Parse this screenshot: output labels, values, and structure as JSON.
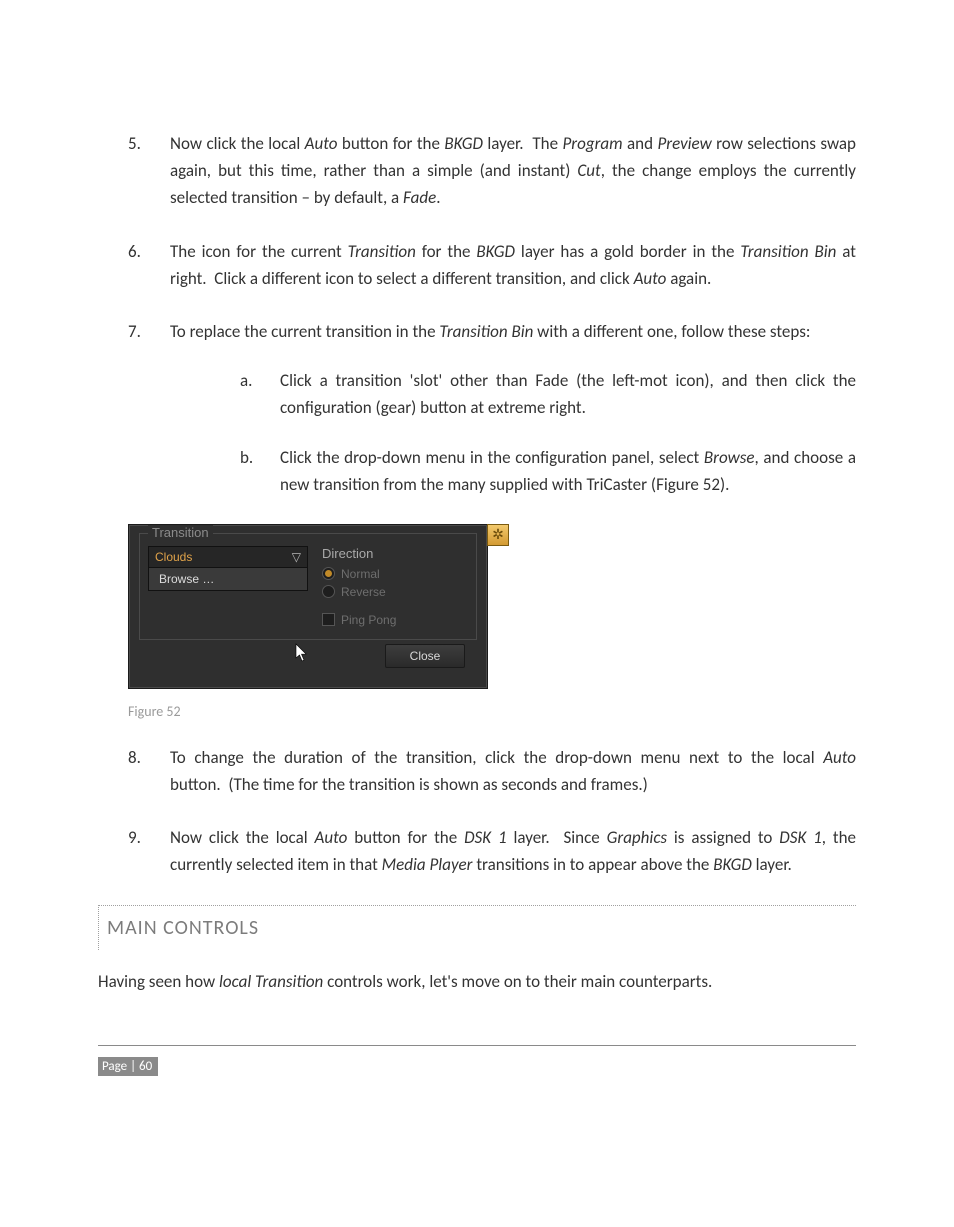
{
  "list": {
    "item5": {
      "num": "5.",
      "html": "Now click the local <em>Auto</em> button for the <em>BKGD</em> layer.&nbsp;&nbsp;The <em>Program</em> and <em>Preview</em> row selections swap again, but this time, rather than a simple (and instant) <em>Cut</em>, the change employs the currently selected transition – by default, a <em>Fade</em>."
    },
    "item6": {
      "num": "6.",
      "html": "The icon for the current <em>Transition</em> for the <em>BKGD</em> layer has a gold border in the <em>Transition Bin</em> at right.&nbsp;&nbsp;Click a different icon to select a different transition, and click <em>Auto</em> again."
    },
    "item7": {
      "num": "7.",
      "html": "To replace the current transition in the <em>Transition Bin</em> with a different one, follow these steps:",
      "a": {
        "num": "a.",
        "html": "Click a transition 'slot' other than Fade (the left-mot icon), and then click the configuration (gear) button at extreme right."
      },
      "b": {
        "num": "b.",
        "html": "Click the drop-down menu in the configuration panel, select <em>Browse</em>, and choose a new transition from the many supplied with TriCaster (Figure 52)."
      }
    },
    "item8": {
      "num": "8.",
      "html": "To change the duration of the transition, click the drop-down menu next to the local <em>Auto</em> button.&nbsp;&nbsp;(The time for the transition is shown as seconds and frames.)"
    },
    "item9": {
      "num": "9.",
      "html": "Now click the local <em>Auto</em> button for the <em>DSK 1</em> layer.&nbsp;&nbsp;Since <em>Graphics</em> is assigned to <em>DSK 1</em>, the currently selected item in that <em>Media Player</em> transitions in to appear above the <em>BKGD</em> layer."
    }
  },
  "panel": {
    "legend": "Transition",
    "dropdown_value": "Clouds",
    "dropdown_item": "Browse …",
    "direction_label": "Direction",
    "normal_label": "Normal",
    "reverse_label": "Reverse",
    "pingpong_label": "Ping Pong",
    "close_label": "Close",
    "gear_glyph": "✲",
    "cursor_glyph": "➤",
    "chevron_glyph": "▽"
  },
  "figure_caption": "Figure 52",
  "section_heading": "MAIN CONTROLS",
  "closing_para_html": "Having seen how <em>local Transition</em> controls work, let's move on to their main counterparts.",
  "page_footer": "Page | 60"
}
